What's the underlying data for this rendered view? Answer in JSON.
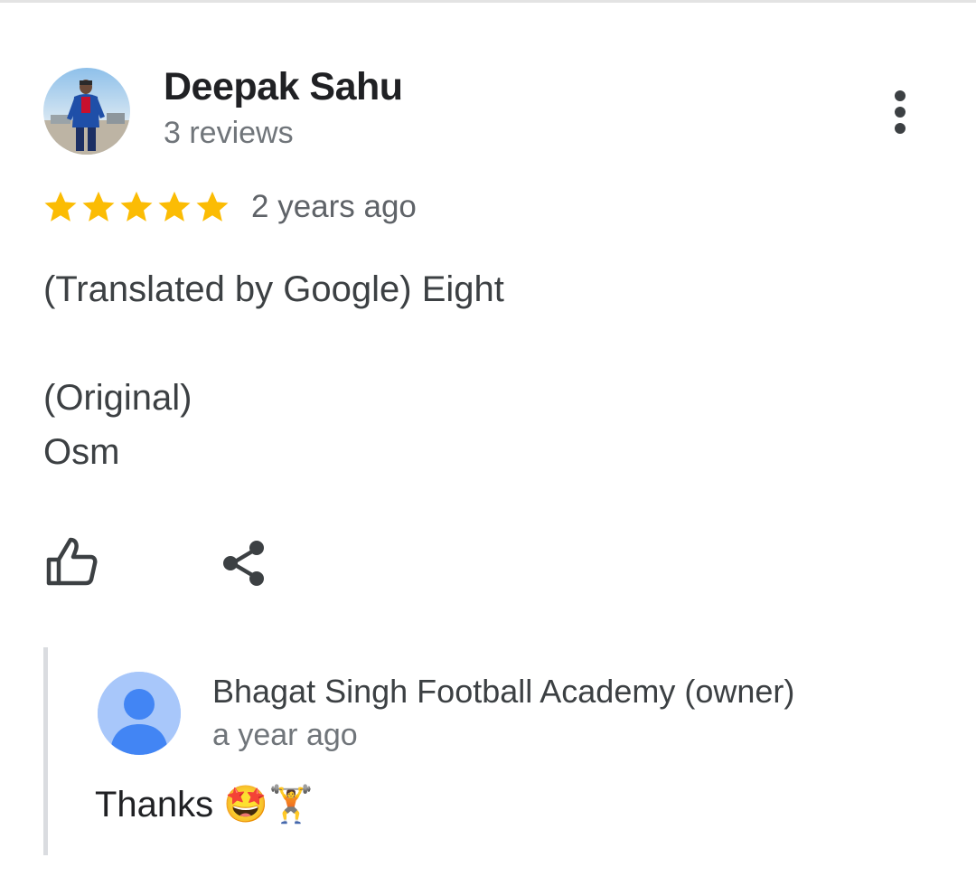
{
  "reviewer": {
    "name": "Deepak Sahu",
    "review_count": "3 reviews"
  },
  "review": {
    "rating": 5,
    "max_rating": 5,
    "time": "2 years ago",
    "translated_line": "(Translated by Google) Eight",
    "original_label": "(Original)",
    "original_text": "Osm"
  },
  "actions": {
    "like_icon": "thumb-up-outline-icon",
    "share_icon": "share-icon",
    "more_icon": "more-vert-icon"
  },
  "owner_response": {
    "name": "Bhagat Singh Football Academy (owner)",
    "time": "a year ago",
    "text": "Thanks 🤩🏋️"
  },
  "colors": {
    "star": "#fbbc04",
    "owner_avatar_bg": "#a8c7fa",
    "owner_avatar_fg": "#4285f4",
    "reply_border": "#dadce0"
  }
}
